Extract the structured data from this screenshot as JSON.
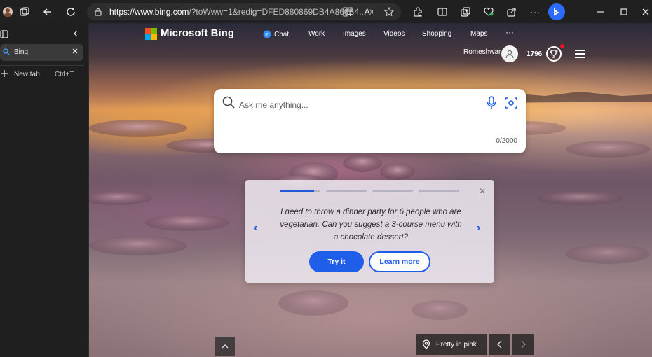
{
  "browser": {
    "url_domain": "https://www.bing.com",
    "url_rest": "/?toWww=1&redig=DFED880869DB4A868B4..."
  },
  "sidebar": {
    "search_value": "Bing",
    "new_tab_label": "New tab",
    "new_tab_shortcut": "Ctrl+T"
  },
  "bing": {
    "logo_text": "Microsoft Bing",
    "nav": [
      "Chat",
      "Work",
      "Images",
      "Videos",
      "Shopping",
      "Maps",
      "···"
    ],
    "user_name": "Romeshwar",
    "points": "1796",
    "search_placeholder": "Ask me anything...",
    "char_counter": "0/2000"
  },
  "card": {
    "progress_fraction": 0.85,
    "text": "I need to throw a dinner party for 6 people who are vegetarian. Can you suggest a 3-course menu with a chocolate dessert?",
    "try_label": "Try it",
    "learn_label": "Learn more"
  },
  "footer": {
    "image_title": "Pretty in pink"
  },
  "colors": {
    "accent": "#1f5ee8",
    "ms_red": "#f25022",
    "ms_green": "#7fba00",
    "ms_blue": "#00a4ef",
    "ms_yellow": "#ffb900"
  }
}
